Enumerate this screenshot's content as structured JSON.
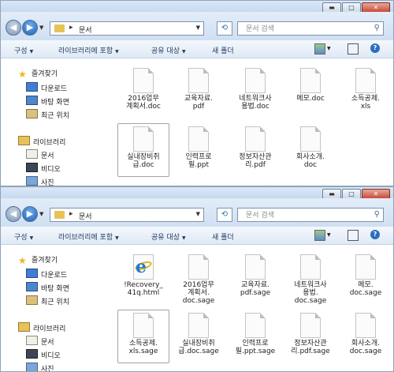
{
  "windows": [
    {
      "caption": {
        "minimize": "▬",
        "maximize": "□",
        "close": "✕"
      },
      "address": {
        "path": "문서",
        "separator": "▸"
      },
      "search": {
        "placeholder": "문서 검색"
      },
      "toolbar": {
        "organize": "구성",
        "include_library": "라이브러리에 포함",
        "share": "공유 대상",
        "new_folder": "새 폴더"
      },
      "sidebar": {
        "favorites": "즐겨찾기",
        "favorites_items": [
          "다운로드",
          "바탕 화면",
          "최근 위치"
        ],
        "libraries": "라이브러리",
        "library_items": [
          "문서",
          "비디오",
          "사진"
        ]
      },
      "files": [
        {
          "name": "2016업무\n계획서.doc"
        },
        {
          "name": "교육자료.\npdf"
        },
        {
          "name": "네트워크사\n용법.doc"
        },
        {
          "name": "메모.doc"
        },
        {
          "name": "소득공제.\nxls"
        },
        {
          "name": "실내장비취\n급.doc"
        },
        {
          "name": "인력프로\n필.ppt"
        },
        {
          "name": "정보자산관\n리.pdf"
        },
        {
          "name": "회사소개.\ndoc"
        }
      ]
    },
    {
      "caption": {
        "minimize": "▬",
        "maximize": "□",
        "close": "✕"
      },
      "address": {
        "path": "문서",
        "separator": "▸"
      },
      "search": {
        "placeholder": "문서 검색"
      },
      "toolbar": {
        "organize": "구성",
        "include_library": "라이브러리에 포함",
        "share": "공유 대상",
        "new_folder": "새 폴더"
      },
      "sidebar": {
        "favorites": "즐겨찾기",
        "favorites_items": [
          "다운로드",
          "바탕 화면",
          "최근 위치"
        ],
        "libraries": "라이브러리",
        "library_items": [
          "문서",
          "비디오",
          "사진"
        ]
      },
      "files": [
        {
          "name": "!Recovery_\n41q.html",
          "icon": "internet-explorer-icon"
        },
        {
          "name": "2016업무\n계획서.\ndoc.sage"
        },
        {
          "name": "교육자료.\npdf.sage"
        },
        {
          "name": "네트워크사\n용법.\ndoc.sage"
        },
        {
          "name": "메모.\ndoc.sage"
        },
        {
          "name": "소득공제.\nxls.sage"
        },
        {
          "name": "실내장비취\n급.doc.sage"
        },
        {
          "name": "인력프로\n필.ppt.sage"
        },
        {
          "name": "정보자산관\n리.pdf.sage"
        },
        {
          "name": "회사소개.\ndoc.sage"
        }
      ]
    }
  ]
}
